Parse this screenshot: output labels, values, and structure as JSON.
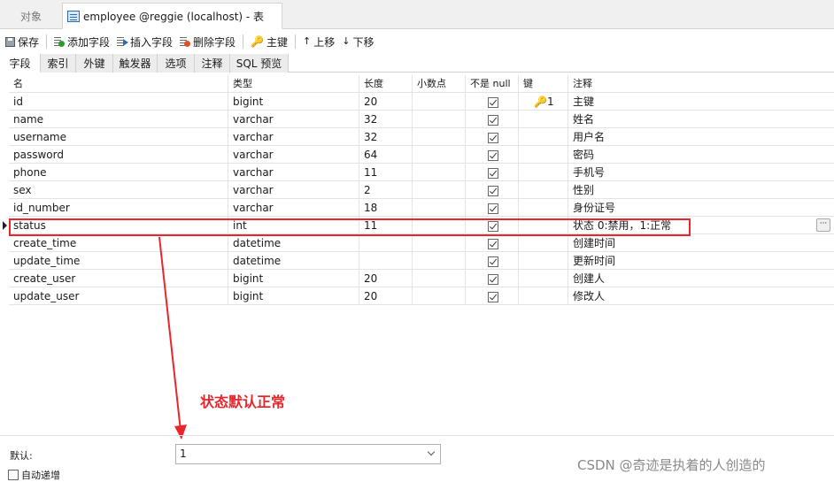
{
  "window_tabs": {
    "objects": "对象",
    "active": "employee @reggie (localhost) - 表"
  },
  "toolbar": {
    "save": "保存",
    "add_field": "添加字段",
    "insert_field": "插入字段",
    "delete_field": "删除字段",
    "primary_key": "主键",
    "move_up": "上移",
    "move_down": "下移"
  },
  "sub_tabs": [
    "字段",
    "索引",
    "外键",
    "触发器",
    "选项",
    "注释",
    "SQL 预览"
  ],
  "grid": {
    "headers": [
      "名",
      "类型",
      "长度",
      "小数点",
      "不是 null",
      "键",
      "注释"
    ],
    "rows": [
      {
        "name": "id",
        "type": "bigint",
        "length": "20",
        "decimal": "",
        "not_null": true,
        "key": "1",
        "comment": "主键"
      },
      {
        "name": "name",
        "type": "varchar",
        "length": "32",
        "decimal": "",
        "not_null": true,
        "key": "",
        "comment": "姓名"
      },
      {
        "name": "username",
        "type": "varchar",
        "length": "32",
        "decimal": "",
        "not_null": true,
        "key": "",
        "comment": "用户名"
      },
      {
        "name": "password",
        "type": "varchar",
        "length": "64",
        "decimal": "",
        "not_null": true,
        "key": "",
        "comment": "密码"
      },
      {
        "name": "phone",
        "type": "varchar",
        "length": "11",
        "decimal": "",
        "not_null": true,
        "key": "",
        "comment": "手机号"
      },
      {
        "name": "sex",
        "type": "varchar",
        "length": "2",
        "decimal": "",
        "not_null": true,
        "key": "",
        "comment": "性别"
      },
      {
        "name": "id_number",
        "type": "varchar",
        "length": "18",
        "decimal": "",
        "not_null": true,
        "key": "",
        "comment": "身份证号"
      },
      {
        "name": "status",
        "type": "int",
        "length": "11",
        "decimal": "",
        "not_null": true,
        "key": "",
        "comment": "状态 0:禁用，1:正常"
      },
      {
        "name": "create_time",
        "type": "datetime",
        "length": "",
        "decimal": "",
        "not_null": true,
        "key": "",
        "comment": "创建时间"
      },
      {
        "name": "update_time",
        "type": "datetime",
        "length": "",
        "decimal": "",
        "not_null": true,
        "key": "",
        "comment": "更新时间"
      },
      {
        "name": "create_user",
        "type": "bigint",
        "length": "20",
        "decimal": "",
        "not_null": true,
        "key": "",
        "comment": "创建人"
      },
      {
        "name": "update_user",
        "type": "bigint",
        "length": "20",
        "decimal": "",
        "not_null": true,
        "key": "",
        "comment": "修改人"
      }
    ],
    "selected_row_index": 7,
    "ellipsis": "···"
  },
  "annotation": {
    "text": "状态默认正常",
    "color": "#e8262b"
  },
  "bottom": {
    "default_label": "默认:",
    "default_value": "1",
    "auto_increment_label": "自动递增",
    "auto_increment_checked": false
  },
  "watermark": "CSDN @奇迹是执着的人创造的",
  "icons": {
    "table": "table-icon",
    "save": "save-icon",
    "add": "add-field-icon",
    "insert": "insert-field-icon",
    "delete": "delete-field-icon",
    "key": "key-icon",
    "up": "arrow-up-icon",
    "down": "arrow-down-icon"
  }
}
